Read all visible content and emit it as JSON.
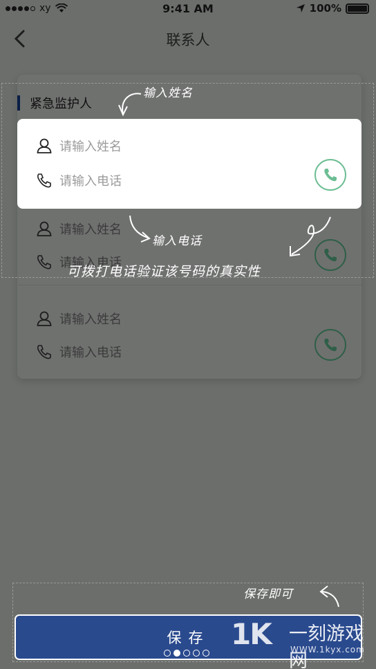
{
  "status_bar": {
    "carrier": "xy",
    "time": "9:41 AM",
    "battery": "100%"
  },
  "nav": {
    "title": "联系人"
  },
  "section": {
    "title": "紧急监护人"
  },
  "contacts": [
    {
      "name_placeholder": "请输入姓名",
      "phone_placeholder": "请输入电话"
    },
    {
      "name_placeholder": "请输入姓名",
      "phone_placeholder": "请输入电话"
    },
    {
      "name_placeholder": "请输入姓名",
      "phone_placeholder": "请输入电话"
    }
  ],
  "annotations": {
    "name_hint": "输入姓名",
    "phone_hint": "输入电话",
    "call_hint": "可拨打电话验证该号码的真实性",
    "save_hint": "保存即可"
  },
  "footer": {
    "save_label": "保存",
    "page_dots": {
      "count": 5,
      "active": 1
    }
  },
  "watermark": {
    "logo": "1K",
    "name": "一刻游戏网",
    "url": "WWW.1kyx.com"
  },
  "colors": {
    "accent": "#2a4a8e",
    "call_green": "#6bbd93",
    "overlay": "#6b6e6b"
  },
  "icons": {
    "back": "chevron-left-icon",
    "person": "person-icon",
    "phone": "phone-icon",
    "call": "phone-call-icon"
  }
}
